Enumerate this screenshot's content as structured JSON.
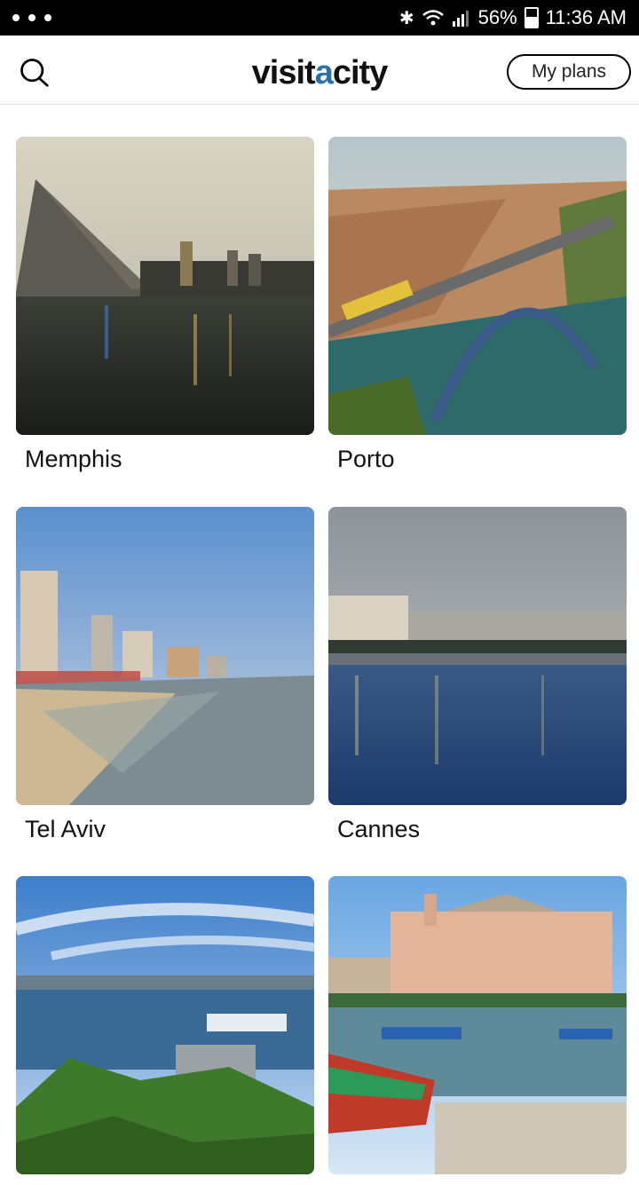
{
  "status_bar": {
    "battery": "56%",
    "time": "11:36 AM",
    "icons": [
      "bluetooth-icon",
      "wifi-icon",
      "signal-icon",
      "battery-icon"
    ]
  },
  "header": {
    "search_icon": "search-icon",
    "logo": {
      "part1": "visit",
      "accent": "a",
      "part2": "city"
    },
    "my_plans_label": "My plans",
    "accent_color": "#2b6fb0"
  },
  "cities": [
    {
      "name": "Memphis"
    },
    {
      "name": "Porto"
    },
    {
      "name": "Tel Aviv"
    },
    {
      "name": "Cannes"
    },
    {
      "name": ""
    },
    {
      "name": ""
    }
  ]
}
